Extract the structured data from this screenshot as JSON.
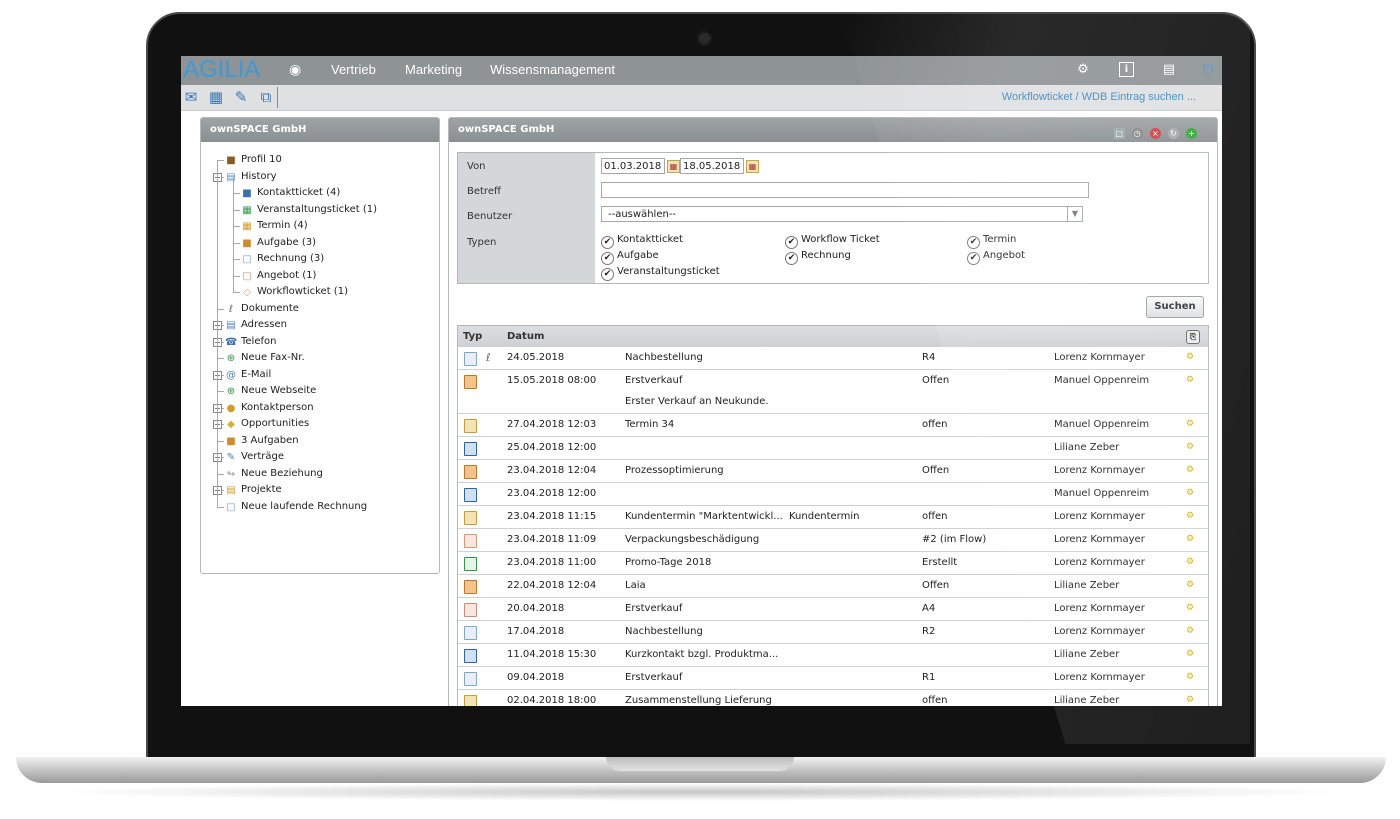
{
  "app": {
    "logo": "AGILIA"
  },
  "nav": {
    "items": [
      "Vertrieb",
      "Marketing",
      "Wissensmanagement"
    ]
  },
  "toolbar": {
    "breadcrumb": "Workflowticket / WDB Eintrag suchen ..."
  },
  "left_panel": {
    "title": "ownSPACE GmbH",
    "tree": [
      {
        "label": "Profil 10",
        "icon": "profile-icon",
        "indent": 1
      },
      {
        "label": "History",
        "icon": "history-icon",
        "indent": 1,
        "expander": "minus"
      },
      {
        "label": "Kontaktticket (4)",
        "icon": "contact-ticket-icon",
        "indent": 2
      },
      {
        "label": "Veranstaltungsticket (1)",
        "icon": "event-ticket-icon",
        "indent": 2
      },
      {
        "label": "Termin (4)",
        "icon": "appointment-icon",
        "indent": 2
      },
      {
        "label": "Aufgabe (3)",
        "icon": "task-icon",
        "indent": 2
      },
      {
        "label": "Rechnung (3)",
        "icon": "invoice-icon",
        "indent": 2
      },
      {
        "label": "Angebot (1)",
        "icon": "offer-icon",
        "indent": 2
      },
      {
        "label": "Workflowticket (1)",
        "icon": "workflow-ticket-icon",
        "indent": 2
      },
      {
        "label": "Dokumente",
        "icon": "paperclip-icon",
        "indent": 1
      },
      {
        "label": "Adressen",
        "icon": "address-icon",
        "indent": 1,
        "expander": "plus"
      },
      {
        "label": "Telefon",
        "icon": "phone-icon",
        "indent": 1,
        "expander": "plus"
      },
      {
        "label": "Neue Fax-Nr.",
        "icon": "add-icon",
        "indent": 1
      },
      {
        "label": "E-Mail",
        "icon": "email-icon",
        "indent": 1,
        "expander": "plus"
      },
      {
        "label": "Neue Webseite",
        "icon": "add-icon",
        "indent": 1
      },
      {
        "label": "Kontaktperson",
        "icon": "person-icon",
        "indent": 1,
        "expander": "plus"
      },
      {
        "label": "Opportunities",
        "icon": "opportunity-icon",
        "indent": 1,
        "expander": "plus"
      },
      {
        "label": "3 Aufgaben",
        "icon": "task-icon",
        "indent": 1
      },
      {
        "label": "Verträge",
        "icon": "contract-icon",
        "indent": 1,
        "expander": "plus"
      },
      {
        "label": "Neue Beziehung",
        "icon": "relation-icon",
        "indent": 1
      },
      {
        "label": "Projekte",
        "icon": "project-icon",
        "indent": 1,
        "expander": "plus"
      },
      {
        "label": "Neue laufende Rechnung",
        "icon": "invoice-icon",
        "indent": 1
      }
    ]
  },
  "right_panel": {
    "title": "ownSPACE GmbH"
  },
  "form": {
    "von_label": "Von",
    "betreff_label": "Betreff",
    "benutzer_label": "Benutzer",
    "typen_label": "Typen",
    "date_from": "01.03.2018",
    "date_to": "18.05.2018",
    "betreff_value": "",
    "benutzer_value": "--auswählen--",
    "types": [
      {
        "label": "Kontaktticket",
        "checked": true
      },
      {
        "label": "Workflow Ticket",
        "checked": true
      },
      {
        "label": "Termin",
        "checked": true
      },
      {
        "label": "Aufgabe",
        "checked": true
      },
      {
        "label": "Rechnung",
        "checked": true
      },
      {
        "label": "Angebot",
        "checked": true
      },
      {
        "label": "Veranstaltungsticket",
        "checked": true
      }
    ],
    "search_button": "Suchen"
  },
  "table": {
    "headers": {
      "typ": "Typ",
      "datum": "Datum"
    },
    "rows": [
      {
        "type": "invoice",
        "attach": true,
        "date": "24.05.2018",
        "subject": "Nachbestellung",
        "extra": "",
        "status": "R4",
        "user": "Lorenz Kornmayer"
      },
      {
        "type": "task",
        "attach": false,
        "date": "15.05.2018 08:00",
        "subject": "Erstverkauf",
        "extra": "",
        "status": "Offen",
        "user": "Manuel Oppenreim",
        "note": "Erster Verkauf an Neukunde."
      },
      {
        "type": "appointment",
        "attach": false,
        "date": "27.04.2018 12:03",
        "subject": "Termin 34",
        "extra": "",
        "status": "offen",
        "user": "Manuel Oppenreim"
      },
      {
        "type": "contact",
        "attach": false,
        "date": "25.04.2018 12:00",
        "subject": "",
        "extra": "",
        "status": "",
        "user": "Liliane Zeber"
      },
      {
        "type": "task",
        "attach": false,
        "date": "23.04.2018 12:04",
        "subject": "Prozessoptimierung",
        "extra": "",
        "status": "Offen",
        "user": "Lorenz Kornmayer"
      },
      {
        "type": "contact",
        "attach": false,
        "date": "23.04.2018 12:00",
        "subject": "",
        "extra": "",
        "status": "",
        "user": "Manuel Oppenreim"
      },
      {
        "type": "appointment",
        "attach": false,
        "date": "23.04.2018 11:15",
        "subject": "Kundentermin \"Marktentwickl...",
        "extra": "Kundentermin",
        "status": "offen",
        "user": "Lorenz Kornmayer"
      },
      {
        "type": "workflow",
        "attach": false,
        "date": "23.04.2018 11:09",
        "subject": "Verpackungsbeschädigung",
        "extra": "",
        "status": "#2 (im Flow)",
        "user": "Lorenz Kornmayer"
      },
      {
        "type": "event",
        "attach": false,
        "date": "23.04.2018 11:00",
        "subject": "Promo-Tage 2018",
        "extra": "",
        "status": "Erstellt",
        "user": "Lorenz Kornmayer"
      },
      {
        "type": "task",
        "attach": false,
        "date": "22.04.2018 12:04",
        "subject": "Laia",
        "extra": "",
        "status": "Offen",
        "user": "Liliane Zeber"
      },
      {
        "type": "offer",
        "attach": false,
        "date": "20.04.2018",
        "subject": "Erstverkauf",
        "extra": "",
        "status": "A4",
        "user": "Lorenz Kornmayer"
      },
      {
        "type": "invoice",
        "attach": false,
        "date": "17.04.2018",
        "subject": "Nachbestellung",
        "extra": "",
        "status": "R2",
        "user": "Lorenz Kornmayer"
      },
      {
        "type": "contact",
        "attach": false,
        "date": "11.04.2018 15:30",
        "subject": "Kurzkontakt bzgl. Produktma...",
        "extra": "",
        "status": "",
        "user": "Liliane Zeber"
      },
      {
        "type": "invoice",
        "attach": false,
        "date": "09.04.2018",
        "subject": "Erstverkauf",
        "extra": "",
        "status": "R1",
        "user": "Lorenz Kornmayer"
      },
      {
        "type": "appointment",
        "attach": false,
        "date": "02.04.2018 18:00",
        "subject": "Zusammenstellung Lieferung",
        "extra": "",
        "status": "offen",
        "user": "Liliane Zeber"
      }
    ]
  }
}
